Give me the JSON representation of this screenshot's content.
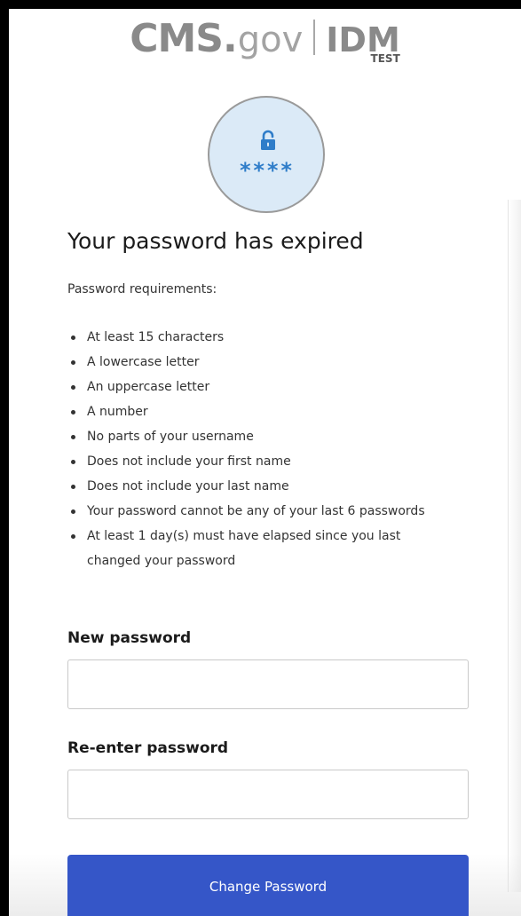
{
  "logo": {
    "brand": "CMS.",
    "domain": "gov",
    "product": "IDM",
    "environment": "TEST"
  },
  "badge": {
    "icon": "lock-icon",
    "masked_text": "****",
    "accent_color": "#2f7dc9",
    "background_color": "#dbeaf7"
  },
  "page": {
    "title": "Your password has expired"
  },
  "requirements": {
    "intro": "Password requirements:",
    "items": [
      "At least 15 characters",
      "A lowercase letter",
      "An uppercase letter",
      "A number",
      "No parts of your username",
      "Does not include your first name",
      "Does not include your last name",
      "Your password cannot be any of your last 6 passwords",
      "At least 1 day(s) must have elapsed since you last changed your password"
    ]
  },
  "form": {
    "new_password_label": "New password",
    "new_password_value": "",
    "reenter_password_label": "Re-enter password",
    "reenter_password_value": "",
    "submit_label": "Change Password",
    "submit_color": "#3556c8"
  }
}
